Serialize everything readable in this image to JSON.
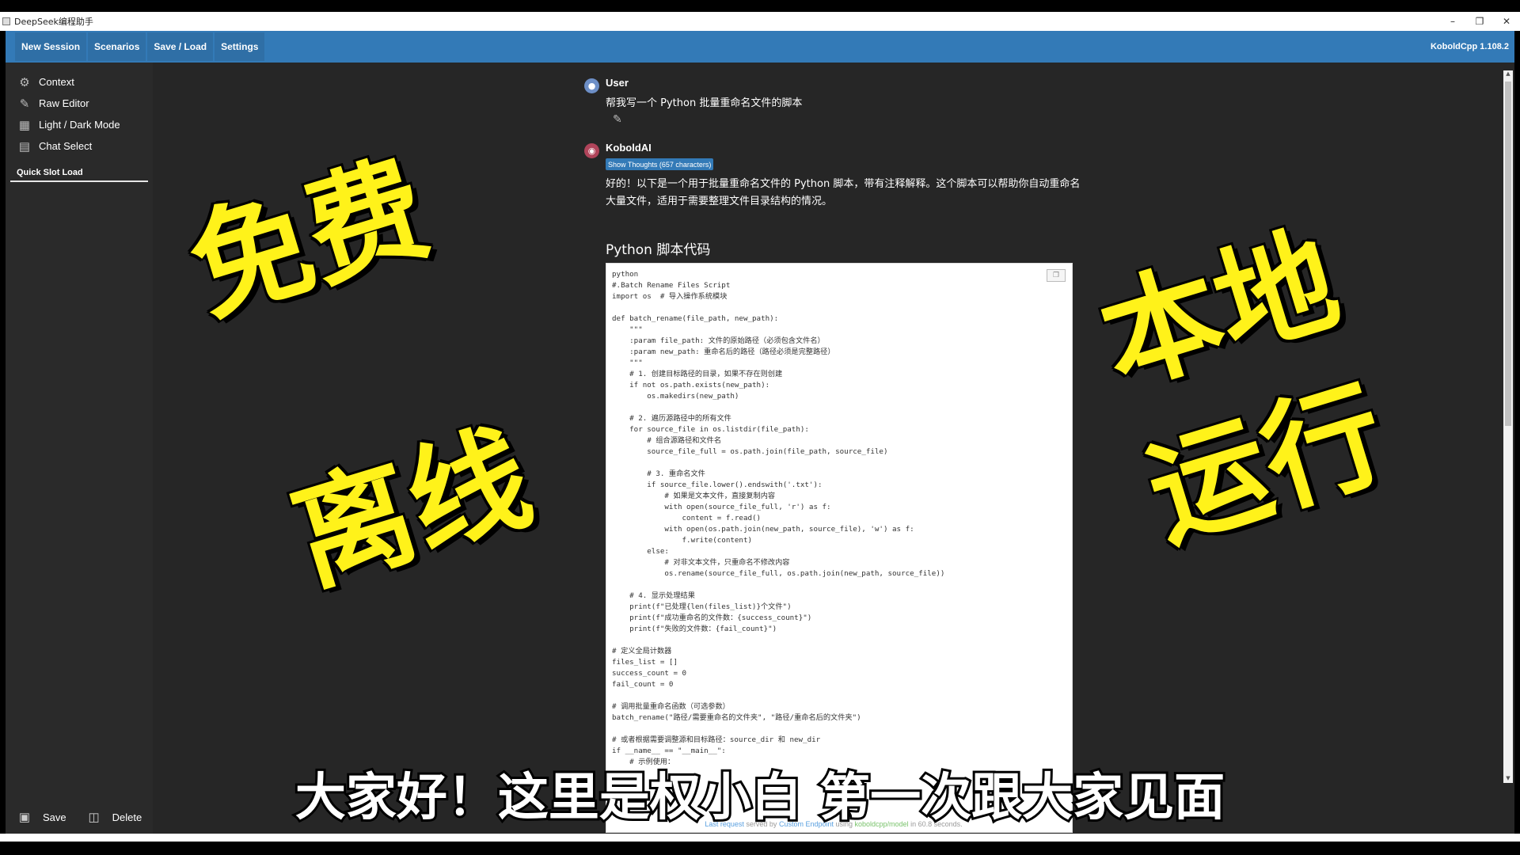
{
  "window": {
    "title": "DeepSeek编程助手"
  },
  "topnav": {
    "buttons": [
      "New Session",
      "Scenarios",
      "Save / Load",
      "Settings"
    ],
    "version": "KoboldCpp 1.108.2"
  },
  "sidebar": {
    "items": [
      {
        "label": "Context",
        "icon": "gear-icon"
      },
      {
        "label": "Raw Editor",
        "icon": "pencil-icon"
      },
      {
        "label": "Light / Dark Mode",
        "icon": "grid-icon"
      },
      {
        "label": "Chat Select",
        "icon": "chat-icon"
      }
    ],
    "quick_slot_label": "Quick Slot Load",
    "save_label": "Save",
    "delete_label": "Delete"
  },
  "chat": {
    "user": {
      "name": "User",
      "text": "帮我写一个 Python 批量重命名文件的脚本"
    },
    "ai": {
      "name": "KoboldAI",
      "thoughts_button": "Show Thoughts (657 characters)",
      "intro": "好的！以下是一个用于批量重命名文件的 Python 脚本，带有注释解释。这个脚本可以帮助你自动重命名大量文件，适用于需要整理文件目录结构的情况。",
      "heading": "Python 脚本代码",
      "code": "python\n#.Batch Rename Files Script\nimport os  # 导入操作系统模块\n\ndef batch_rename(file_path, new_path):\n    \"\"\"\n    :param file_path: 文件的原始路径（必须包含文件名）\n    :param new_path: 重命名后的路径（路径必须是完整路径）\n    \"\"\"\n    # 1. 创建目标路径的目录，如果不存在则创建\n    if not os.path.exists(new_path):\n        os.makedirs(new_path)\n\n    # 2. 遍历源路径中的所有文件\n    for source_file in os.listdir(file_path):\n        # 组合源路径和文件名\n        source_file_full = os.path.join(file_path, source_file)\n\n        # 3. 重命名文件\n        if source_file.lower().endswith('.txt'):\n            # 如果是文本文件，直接复制内容\n            with open(source_file_full, 'r') as f:\n                content = f.read()\n            with open(os.path.join(new_path, source_file), 'w') as f:\n                f.write(content)\n        else:\n            # 对非文本文件，只重命名不修改内容\n            os.rename(source_file_full, os.path.join(new_path, source_file))\n\n    # 4. 显示处理结果\n    print(f\"已处理{len(files_list)}个文件\")\n    print(f\"成功重命名的文件数：{success_count}\")\n    print(f\"失败的文件数：{fail_count}\")\n\n# 定义全局计数器\nfiles_list = []\nsuccess_count = 0\nfail_count = 0\n\n# 调用批量重命名函数（可选参数）\nbatch_rename(\"路径/需要重命名的文件夹\", \"路径/重命名后的文件夹\")\n\n# 或者根据需要调整源和目标路径：source_dir 和 new_dir\nif __name__ == \"__main__\":\n    # 示例使用："
    },
    "footer": {
      "last_request": "Last request",
      "served_by": " served by ",
      "endpoint": "Custom Endpoint",
      "using": " using ",
      "model": "koboldcpp/model",
      "time": " in 60.8 seconds."
    }
  },
  "overlay": {
    "text1": "免费",
    "text2": "离线",
    "text3": "本地",
    "text4": "运行",
    "subtitle": "大家好！这里是权小白 第一次跟大家见面"
  },
  "colors": {
    "nav_blue": "#337ab7",
    "overlay_yellow": "#fff21a",
    "bg_dark": "#262626"
  }
}
